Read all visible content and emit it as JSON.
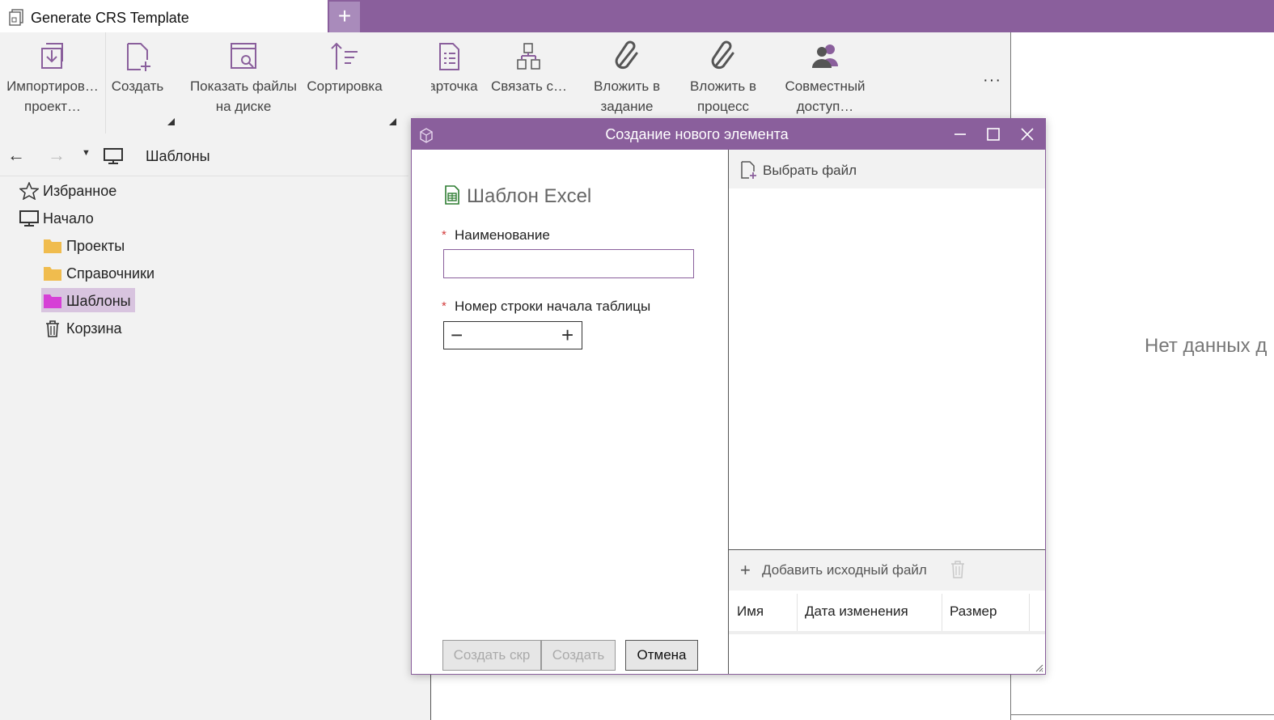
{
  "tab": {
    "title": "Generate CRS Template",
    "add_label": "+"
  },
  "ribbon": {
    "import_label": "Импортиров… проект…",
    "create_label": "Создать",
    "show_files_label": "Показать файлы на диске",
    "sort_label": "Сортировка",
    "card_label": "Карточка",
    "link_label": "Связать с…",
    "attach_task_label": "Вложить в задание",
    "attach_process_label": "Вложить в процесс",
    "share_label": "Совместный доступ…",
    "more_label": "···"
  },
  "nav": {
    "back": "←",
    "forward": "→",
    "dropdown": "▼",
    "path": "Шаблоны"
  },
  "tree": {
    "items": [
      {
        "label": "Избранное"
      },
      {
        "label": "Начало"
      },
      {
        "label": "Проекты"
      },
      {
        "label": "Справочники"
      },
      {
        "label": "Шаблоны"
      },
      {
        "label": "Корзина"
      }
    ]
  },
  "content": {
    "empty_text": "Нет данных д"
  },
  "dialog": {
    "title": "Создание нового элемента",
    "type_title": "Шаблон Excel",
    "required_mark": "*",
    "name_label": "Наименование",
    "name_value": "",
    "row_label": "Номер строки начала таблицы",
    "row_value": "",
    "stepper_minus": "−",
    "stepper_plus": "+",
    "btn_create_close": "Создать скр",
    "btn_create": "Создать",
    "btn_cancel": "Отмена",
    "pick_file_label": "Выбрать файл",
    "add_source_label": "Добавить исходный файл",
    "add_source_plus": "+",
    "grid_columns": [
      "Имя",
      "Дата изменения",
      "Размер"
    ]
  },
  "colors": {
    "accent": "#8a5f9c",
    "selection": "#d8c4df",
    "folder": "#f0bc4e",
    "folder_selected": "#d63fd6",
    "excel_green": "#2e7d32"
  }
}
